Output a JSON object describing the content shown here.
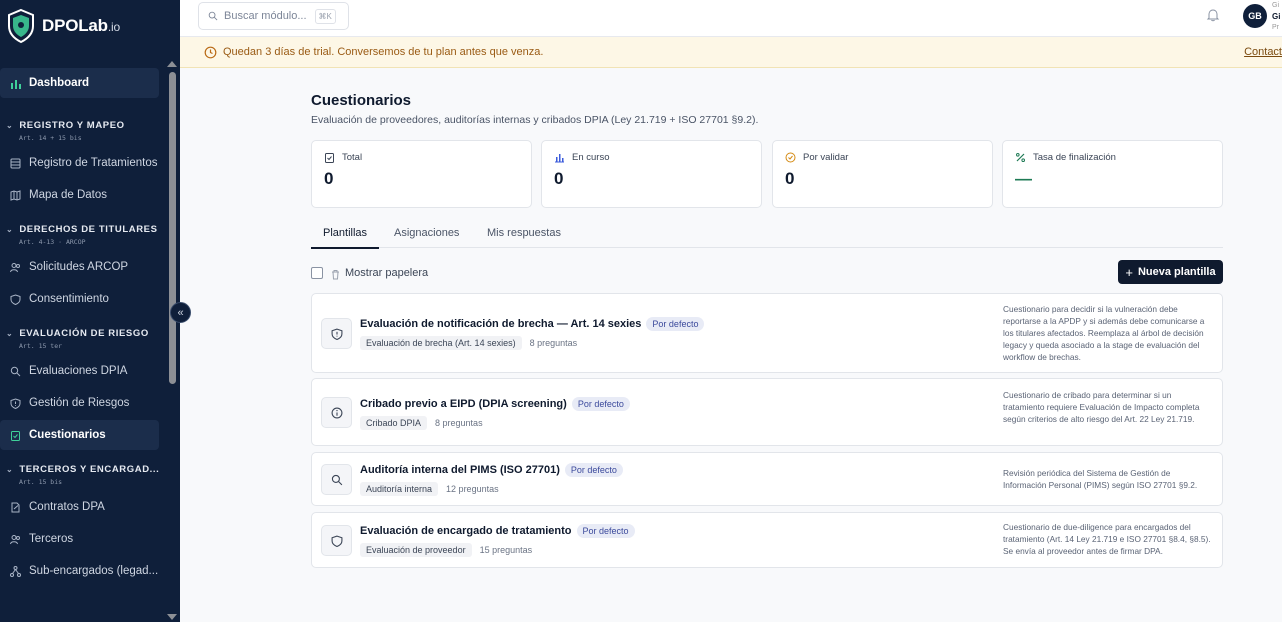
{
  "app": {
    "logo_text": "DPOLab",
    "logo_suffix": ".io"
  },
  "sidebar": {
    "dashboard": "Dashboard",
    "sections": [
      {
        "title": "REGISTRO Y MAPEO",
        "sub": "Art. 14 + 15 bis",
        "items": [
          "Registro de Tratamientos",
          "Mapa de Datos"
        ]
      },
      {
        "title": "DERECHOS DE TITULARES",
        "sub": "Art. 4-13 · ARCOP",
        "items": [
          "Solicitudes ARCOP",
          "Consentimiento"
        ]
      },
      {
        "title": "EVALUACIÓN DE RIESGO",
        "sub": "Art. 15 ter",
        "items": [
          "Evaluaciones DPIA",
          "Gestión de Riesgos",
          "Cuestionarios"
        ]
      },
      {
        "title": "TERCEROS Y ENCARGAD...",
        "sub": "Art. 15 bis",
        "items": [
          "Contratos DPA",
          "Terceros",
          "Sub-encargados (legad..."
        ]
      }
    ],
    "collapse_glyph": "«"
  },
  "header": {
    "search_placeholder": "Buscar módulo...",
    "search_shortcut": "⌘K",
    "avatar_initials": "GB",
    "user_name": "Gi",
    "user_line_top": "Gi",
    "user_role": "Pr"
  },
  "banner": {
    "text": "Quedan 3 días de trial. Conversemos de tu plan antes que venza.",
    "contact": "Contact"
  },
  "page": {
    "title": "Cuestionarios",
    "subtitle": "Evaluación de proveedores, auditorías internas y cribados DPIA (Ley 21.719 + ISO 27701 §9.2)."
  },
  "stats": [
    {
      "label": "Total",
      "value": "0",
      "icon": "clipboard-icon"
    },
    {
      "label": "En curso",
      "value": "0",
      "icon": "bar-chart-icon"
    },
    {
      "label": "Por validar",
      "value": "0",
      "icon": "check-circle-icon"
    },
    {
      "label": "Tasa de finalización",
      "value": "—",
      "icon": "percent-icon"
    }
  ],
  "tabs": [
    "Plantillas",
    "Asignaciones",
    "Mis respuestas"
  ],
  "toolbar": {
    "show_trash": "Mostrar papelera",
    "new_button": "Nueva plantilla"
  },
  "cards": [
    {
      "title": "Evaluación de notificación de brecha — Art. 14 sexies",
      "badge": "Por defecto",
      "tag": "Evaluación de brecha (Art. 14 sexies)",
      "count": "8 preguntas",
      "desc": "Cuestionario para decidir si la vulneración debe reportarse a la APDP y si además debe comunicarse a los titulares afectados. Reemplaza al árbol de decisión legacy y queda asociado a la stage de evaluación del workflow de brechas.",
      "icon": "shield-alert-icon"
    },
    {
      "title": "Cribado previo a EIPD (DPIA screening)",
      "badge": "Por defecto",
      "tag": "Cribado DPIA",
      "count": "8 preguntas",
      "desc": "Cuestionario de cribado para determinar si un tratamiento requiere Evaluación de Impacto completa según criterios de alto riesgo del Art. 22 Ley 21.719.",
      "icon": "info-circle-icon"
    },
    {
      "title": "Auditoría interna del PIMS (ISO 27701)",
      "badge": "Por defecto",
      "tag": "Auditoría interna",
      "count": "12 preguntas",
      "desc": "Revisión periódica del Sistema de Gestión de Información Personal (PIMS) según ISO 27701 §9.2.",
      "icon": "search-icon"
    },
    {
      "title": "Evaluación de encargado de tratamiento",
      "badge": "Por defecto",
      "tag": "Evaluación de proveedor",
      "count": "15 preguntas",
      "desc": "Cuestionario de due-diligence para encargados del tratamiento (Art. 14 Ley 21.719 e ISO 27701 §8.4, §8.5). Se envía al proveedor antes de firmar DPA.",
      "icon": "shield-icon"
    }
  ]
}
